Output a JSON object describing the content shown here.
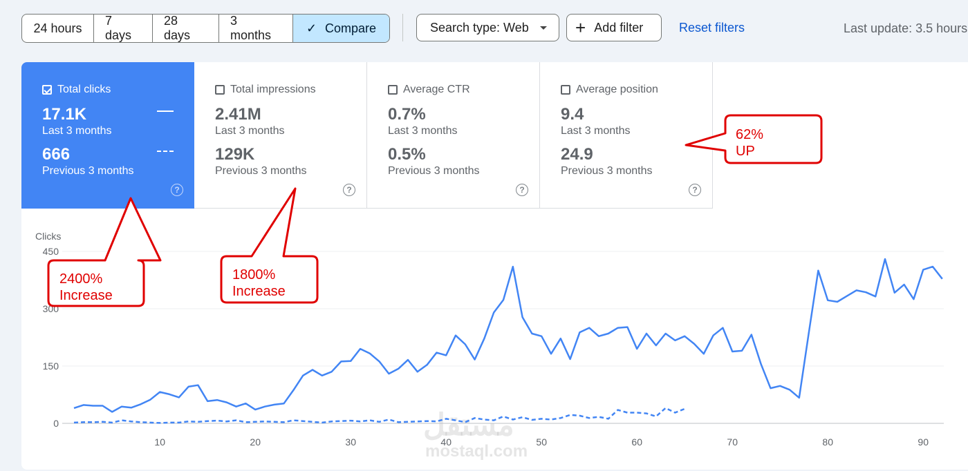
{
  "toolbar": {
    "ranges": [
      "24 hours",
      "7 days",
      "28 days",
      "3 months"
    ],
    "compare_label": "Compare",
    "search_type_label": "Search type: Web",
    "add_filter_label": "Add filter",
    "reset_label": "Reset filters",
    "last_update": "Last update: 3.5 hours"
  },
  "metrics": [
    {
      "label": "Total clicks",
      "checked": true,
      "current": "17.1K",
      "current_period": "Last 3 months",
      "previous": "666",
      "previous_period": "Previous 3 months"
    },
    {
      "label": "Total impressions",
      "checked": false,
      "current": "2.41M",
      "current_period": "Last 3 months",
      "previous": "129K",
      "previous_period": "Previous 3 months"
    },
    {
      "label": "Average CTR",
      "checked": false,
      "current": "0.7%",
      "current_period": "Last 3 months",
      "previous": "0.5%",
      "previous_period": "Previous 3 months"
    },
    {
      "label": "Average position",
      "checked": false,
      "current": "9.4",
      "current_period": "Last 3 months",
      "previous": "24.9",
      "previous_period": "Previous 3 months"
    }
  ],
  "help_glyph": "?",
  "annotations": {
    "clicks": [
      "2400%",
      "Increase"
    ],
    "impressions": [
      "1800%",
      "Increase"
    ],
    "position": [
      "62%",
      "UP"
    ]
  },
  "watermark": {
    "arabic": "مستقل",
    "latin": "mostaql.com"
  },
  "colors": {
    "accent": "#4285f4",
    "series": "#4285f4",
    "callout": "#e00000",
    "button_active": "#c2e7ff"
  },
  "chart_data": {
    "type": "line",
    "ylabel": "Clicks",
    "ylim": [
      0,
      450
    ],
    "yticks": [
      0,
      150,
      300,
      450
    ],
    "xlim": [
      1,
      92
    ],
    "xticks": [
      10,
      20,
      30,
      40,
      50,
      60,
      70,
      80,
      90
    ],
    "grid": true,
    "series": [
      {
        "style": "solid",
        "x_start": 1,
        "values": [
          40,
          48,
          46,
          46,
          30,
          44,
          41,
          50,
          62,
          82,
          76,
          68,
          96,
          100,
          58,
          61,
          55,
          44,
          52,
          36,
          44,
          49,
          52,
          87,
          125,
          140,
          125,
          135,
          162,
          163,
          195,
          183,
          162,
          130,
          143,
          166,
          135,
          153,
          185,
          178,
          230,
          207,
          167,
          222,
          290,
          323,
          410,
          278,
          235,
          228,
          182,
          222,
          168,
          238,
          250,
          228,
          235,
          250,
          252,
          195,
          235,
          204,
          235,
          217,
          228,
          208,
          182,
          230,
          250,
          188,
          190,
          232,
          155,
          92,
          98,
          88,
          67,
          235,
          400,
          322,
          318,
          333,
          348,
          343,
          332,
          430,
          342,
          363,
          325,
          402,
          410,
          378
        ]
      },
      {
        "style": "dashed",
        "x_start": 1,
        "values": [
          2,
          3,
          3,
          4,
          2,
          8,
          5,
          3,
          2,
          1,
          2,
          2,
          5,
          4,
          6,
          7,
          5,
          8,
          3,
          4,
          5,
          4,
          3,
          8,
          6,
          4,
          2,
          5,
          6,
          7,
          5,
          8,
          4,
          10,
          3,
          4,
          5,
          6,
          5,
          12,
          8,
          3,
          14,
          10,
          8,
          18,
          10,
          16,
          9,
          12,
          10,
          14,
          22,
          20,
          14,
          17,
          12,
          35,
          28,
          28,
          26,
          18,
          40,
          28,
          38
        ]
      }
    ]
  }
}
